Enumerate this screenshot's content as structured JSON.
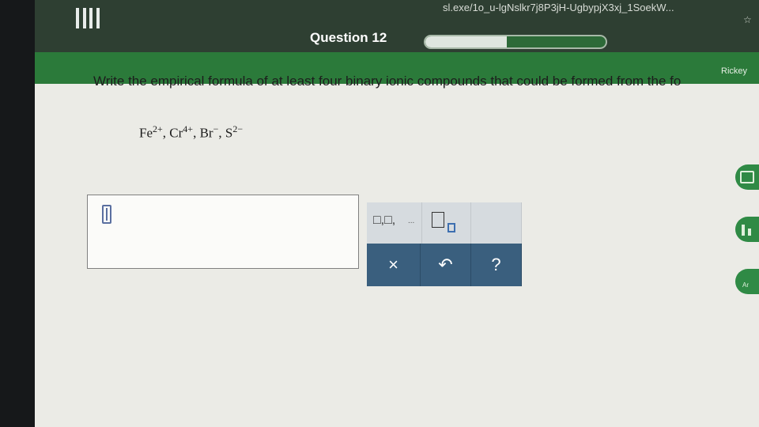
{
  "browser": {
    "url": "sl.exe/1o_u-lgNslkr7j8P3jH-UgbypjX3xj_1SoekW...",
    "star": "☆"
  },
  "header": {
    "menu_icon": "hamburger-menu-icon",
    "question_label": "Question 12",
    "progress": 0.45,
    "user": "Rickey"
  },
  "question": {
    "prompt": "Write the empirical formula of at least four binary ionic compounds that could be formed from the fo",
    "ions": [
      {
        "symbol": "Fe",
        "charge": "2+"
      },
      {
        "symbol": "Cr",
        "charge": "4+"
      },
      {
        "symbol": "Br",
        "charge": "−"
      },
      {
        "symbol": "S",
        "charge": "2−"
      }
    ]
  },
  "answer": {
    "value": "",
    "cursor": "text-cursor-icon"
  },
  "toolbar": {
    "list_template": "□,□,",
    "list_dots": "...",
    "subscript_template": "subscript-template-icon"
  },
  "actions": {
    "clear": "×",
    "undo": "↶",
    "help": "?"
  },
  "side_tools": {
    "calculator": "calculator-icon",
    "data": "bar-chart-icon",
    "periodic_table": "Ar"
  },
  "colors": {
    "header_green": "#2b7a3a",
    "action_blue": "#3a5f7e"
  }
}
